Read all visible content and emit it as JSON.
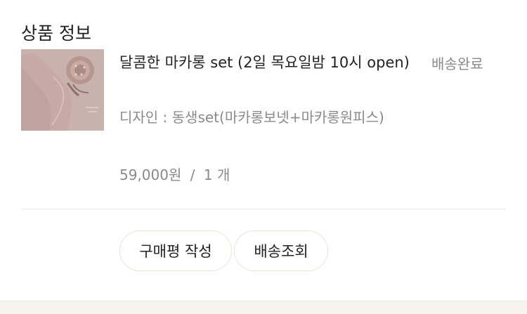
{
  "section": {
    "title": "상품 정보"
  },
  "product": {
    "name": "달콤한 마카롱 set (2일 목요일밤 10시 open)",
    "status": "배송완료",
    "option": "디자인 : 동생set(마카롱보넷+마카롱원피스)",
    "price": "59,000원",
    "separator": "/",
    "quantity": "1 개"
  },
  "actions": {
    "review_label": "구매평 작성",
    "track_label": "배송조회"
  }
}
